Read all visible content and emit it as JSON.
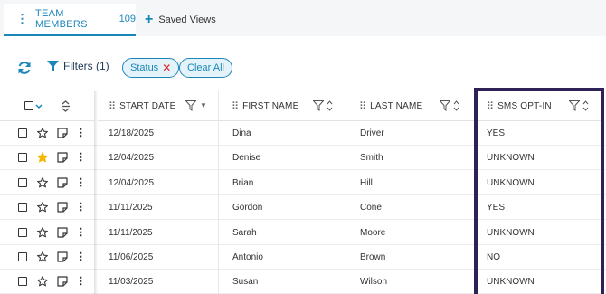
{
  "tabs": {
    "active": {
      "label": "TEAM MEMBERS",
      "count": "109"
    },
    "saved_views": "Saved Views"
  },
  "toolbar": {
    "filters_label": "Filters (1)",
    "chip_status": "Status",
    "chip_clear": "Clear All"
  },
  "columns": {
    "start_date": "START DATE",
    "first_name": "FIRST NAME",
    "last_name": "LAST NAME",
    "sms_opt_in": "SMS OPT-IN"
  },
  "rows": [
    {
      "start_date": "12/18/2025",
      "first_name": "Dina",
      "last_name": "Driver",
      "sms_opt_in": "YES",
      "starred": false
    },
    {
      "start_date": "12/04/2025",
      "first_name": "Denise",
      "last_name": "Smith",
      "sms_opt_in": "UNKNOWN",
      "starred": true
    },
    {
      "start_date": "12/04/2025",
      "first_name": "Brian",
      "last_name": "Hill",
      "sms_opt_in": "UNKNOWN",
      "starred": false
    },
    {
      "start_date": "11/11/2025",
      "first_name": "Gordon",
      "last_name": "Cone",
      "sms_opt_in": "YES",
      "starred": false
    },
    {
      "start_date": "11/11/2025",
      "first_name": "Sarah",
      "last_name": "Moore",
      "sms_opt_in": "UNKNOWN",
      "starred": false
    },
    {
      "start_date": "11/06/2025",
      "first_name": "Antonio",
      "last_name": "Brown",
      "sms_opt_in": "NO",
      "starred": false
    },
    {
      "start_date": "11/03/2025",
      "first_name": "Susan",
      "last_name": "Wilson",
      "sms_opt_in": "UNKNOWN",
      "starred": false
    }
  ],
  "colors": {
    "accent": "#1b87b9",
    "highlight_border": "#2d2157",
    "star_filled": "#f5b800",
    "chip_remove": "#d62020"
  }
}
